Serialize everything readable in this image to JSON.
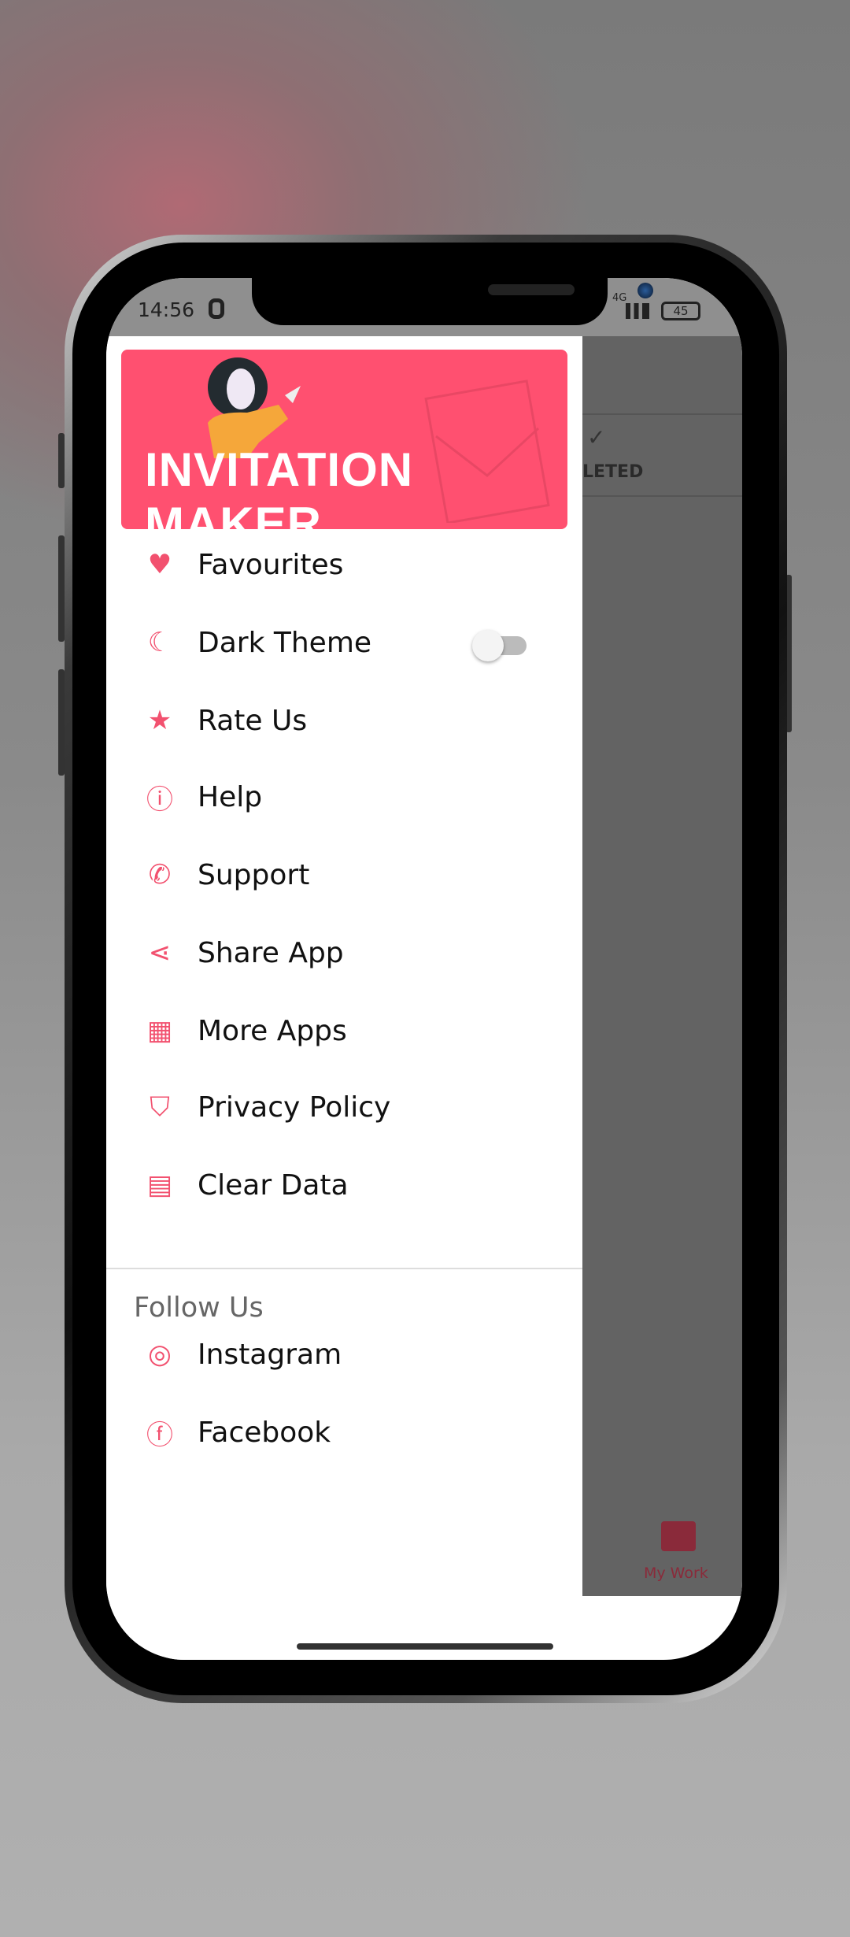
{
  "status_bar": {
    "time": "14:56",
    "network": "4G",
    "battery": "45"
  },
  "banner": {
    "title": "INVITATION MAKER"
  },
  "background_app": {
    "tab_partial_label": "LETED",
    "bottom_nav": {
      "my_work_label": "My Work",
      "my_work_icon": "inbox-tray-icon"
    }
  },
  "menu": {
    "items": [
      {
        "label": "Favourites",
        "icon": "heart-icon"
      },
      {
        "label": "Dark Theme",
        "icon": "moon-icon",
        "toggle": false
      },
      {
        "label": "Rate Us",
        "icon": "star-icon"
      },
      {
        "label": "Help",
        "icon": "info-icon"
      },
      {
        "label": "Support",
        "icon": "phone-icon"
      },
      {
        "label": "Share App",
        "icon": "share-icon"
      },
      {
        "label": "More Apps",
        "icon": "apps-icon"
      },
      {
        "label": "Privacy Policy",
        "icon": "shield-lock-icon"
      },
      {
        "label": "Clear Data",
        "icon": "clear-data-icon"
      }
    ]
  },
  "follow": {
    "heading": "Follow Us",
    "items": [
      {
        "label": "Instagram",
        "icon": "instagram-icon"
      },
      {
        "label": "Facebook",
        "icon": "facebook-icon"
      }
    ]
  },
  "colors": {
    "accent": "#f2516f",
    "banner": "#ff5070",
    "scrim": "#636363",
    "nav_active": "#8a2a3a"
  }
}
